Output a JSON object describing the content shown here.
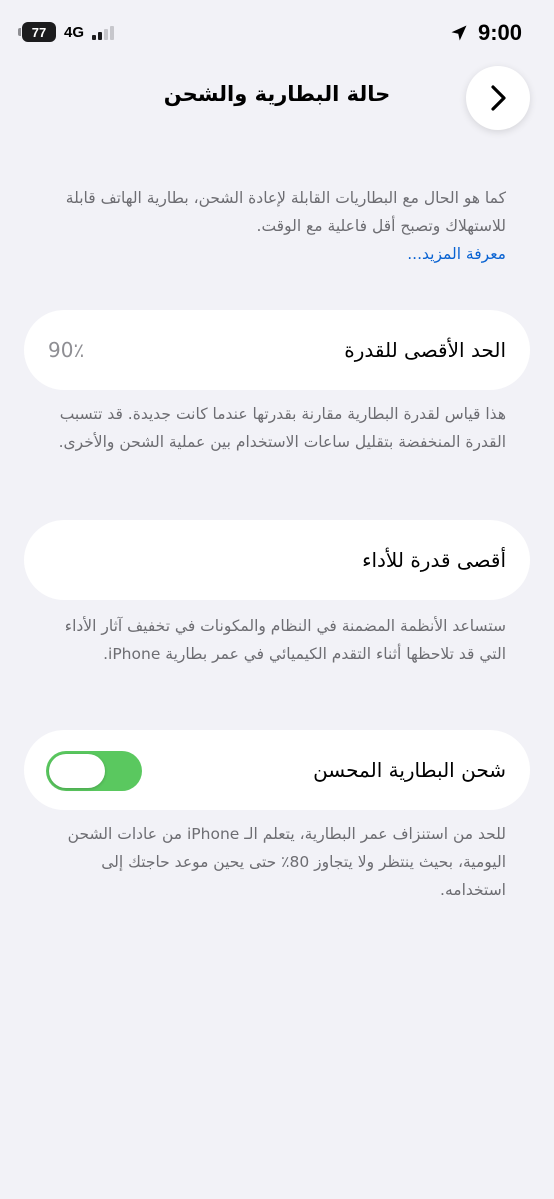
{
  "status_bar": {
    "battery_level": "77",
    "network": "4G",
    "time": "9:00",
    "icons": [
      "battery-icon",
      "signal-icon",
      "location-arrow-icon"
    ]
  },
  "nav": {
    "title": "حالة البطارية والشحن",
    "back_icon": "chevron-right-icon"
  },
  "intro": {
    "text": "كما هو الحال مع البطاريات القابلة لإعادة الشحن، بطارية الهاتف قابلة للاستهلاك وتصبح أقل فاعلية مع الوقت.",
    "learn_more": "معرفة المزيد..."
  },
  "max_capacity": {
    "label": "الحد الأقصى للقدرة",
    "value": "90٪",
    "footnote": "هذا قياس لقدرة البطارية مقارنة بقدرتها عندما كانت جديدة. قد تتسبب القدرة المنخفضة بتقليل ساعات الاستخدام بين عملية الشحن والأخرى."
  },
  "peak_performance": {
    "label": "أقصى قدرة للأداء",
    "footnote": "ستساعد الأنظمة المضمنة في النظام والمكونات في تخفيف آثار الأداء التي قد تلاحظها أثناء التقدم الكيميائي في عمر بطارية iPhone."
  },
  "optimized_charging": {
    "label": "شحن البطارية المحسن",
    "enabled": true,
    "toggle_color": "#5ac85f",
    "footnote": "للحد من استنزاف عمر البطارية، يتعلم الـ iPhone من عادات الشحن اليومية، بحيث ينتظر ولا يتجاوز 80٪ حتى يحين موعد حاجتك إلى استخدامه."
  },
  "colors": {
    "background": "#f2f2f7",
    "card": "#ffffff",
    "footnote_text": "#6d6d72",
    "link": "#0a63d2"
  }
}
